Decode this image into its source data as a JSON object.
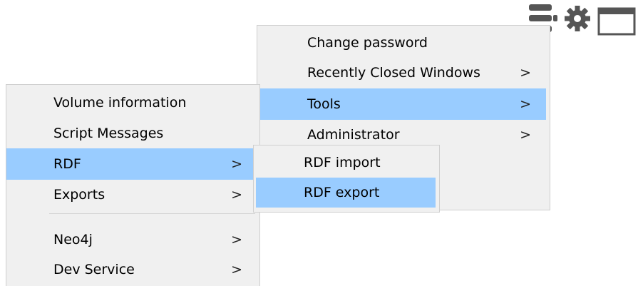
{
  "toolbar": {
    "icons": [
      "menu-lines-icon",
      "gear-icon",
      "window-icon"
    ]
  },
  "tools_menu": {
    "items": [
      {
        "label": "Change password",
        "submenu": false
      },
      {
        "label": "Recently Closed Windows",
        "submenu": true,
        "arrow": ">"
      },
      {
        "label": "Tools",
        "submenu": true,
        "arrow": ">",
        "highlighted": true
      },
      {
        "label": "Administrator",
        "submenu": true,
        "arrow": ">"
      }
    ]
  },
  "left_menu": {
    "items": [
      {
        "label": "Volume information",
        "submenu": false
      },
      {
        "label": "Script Messages",
        "submenu": false
      },
      {
        "label": "RDF",
        "submenu": true,
        "arrow": ">",
        "highlighted": true
      },
      {
        "label": "Exports",
        "submenu": true,
        "arrow": ">"
      },
      {
        "label": "Neo4j",
        "submenu": true,
        "arrow": ">"
      },
      {
        "label": "Dev Service",
        "submenu": true,
        "arrow": ">"
      }
    ]
  },
  "rdf_submenu": {
    "items": [
      {
        "label": "RDF import"
      },
      {
        "label": "RDF export",
        "highlighted": true
      }
    ]
  },
  "colors": {
    "menu_bg": "#f0f0f0",
    "highlight": "#99ccff",
    "border": "#cfcfcf",
    "icon": "#555555"
  }
}
